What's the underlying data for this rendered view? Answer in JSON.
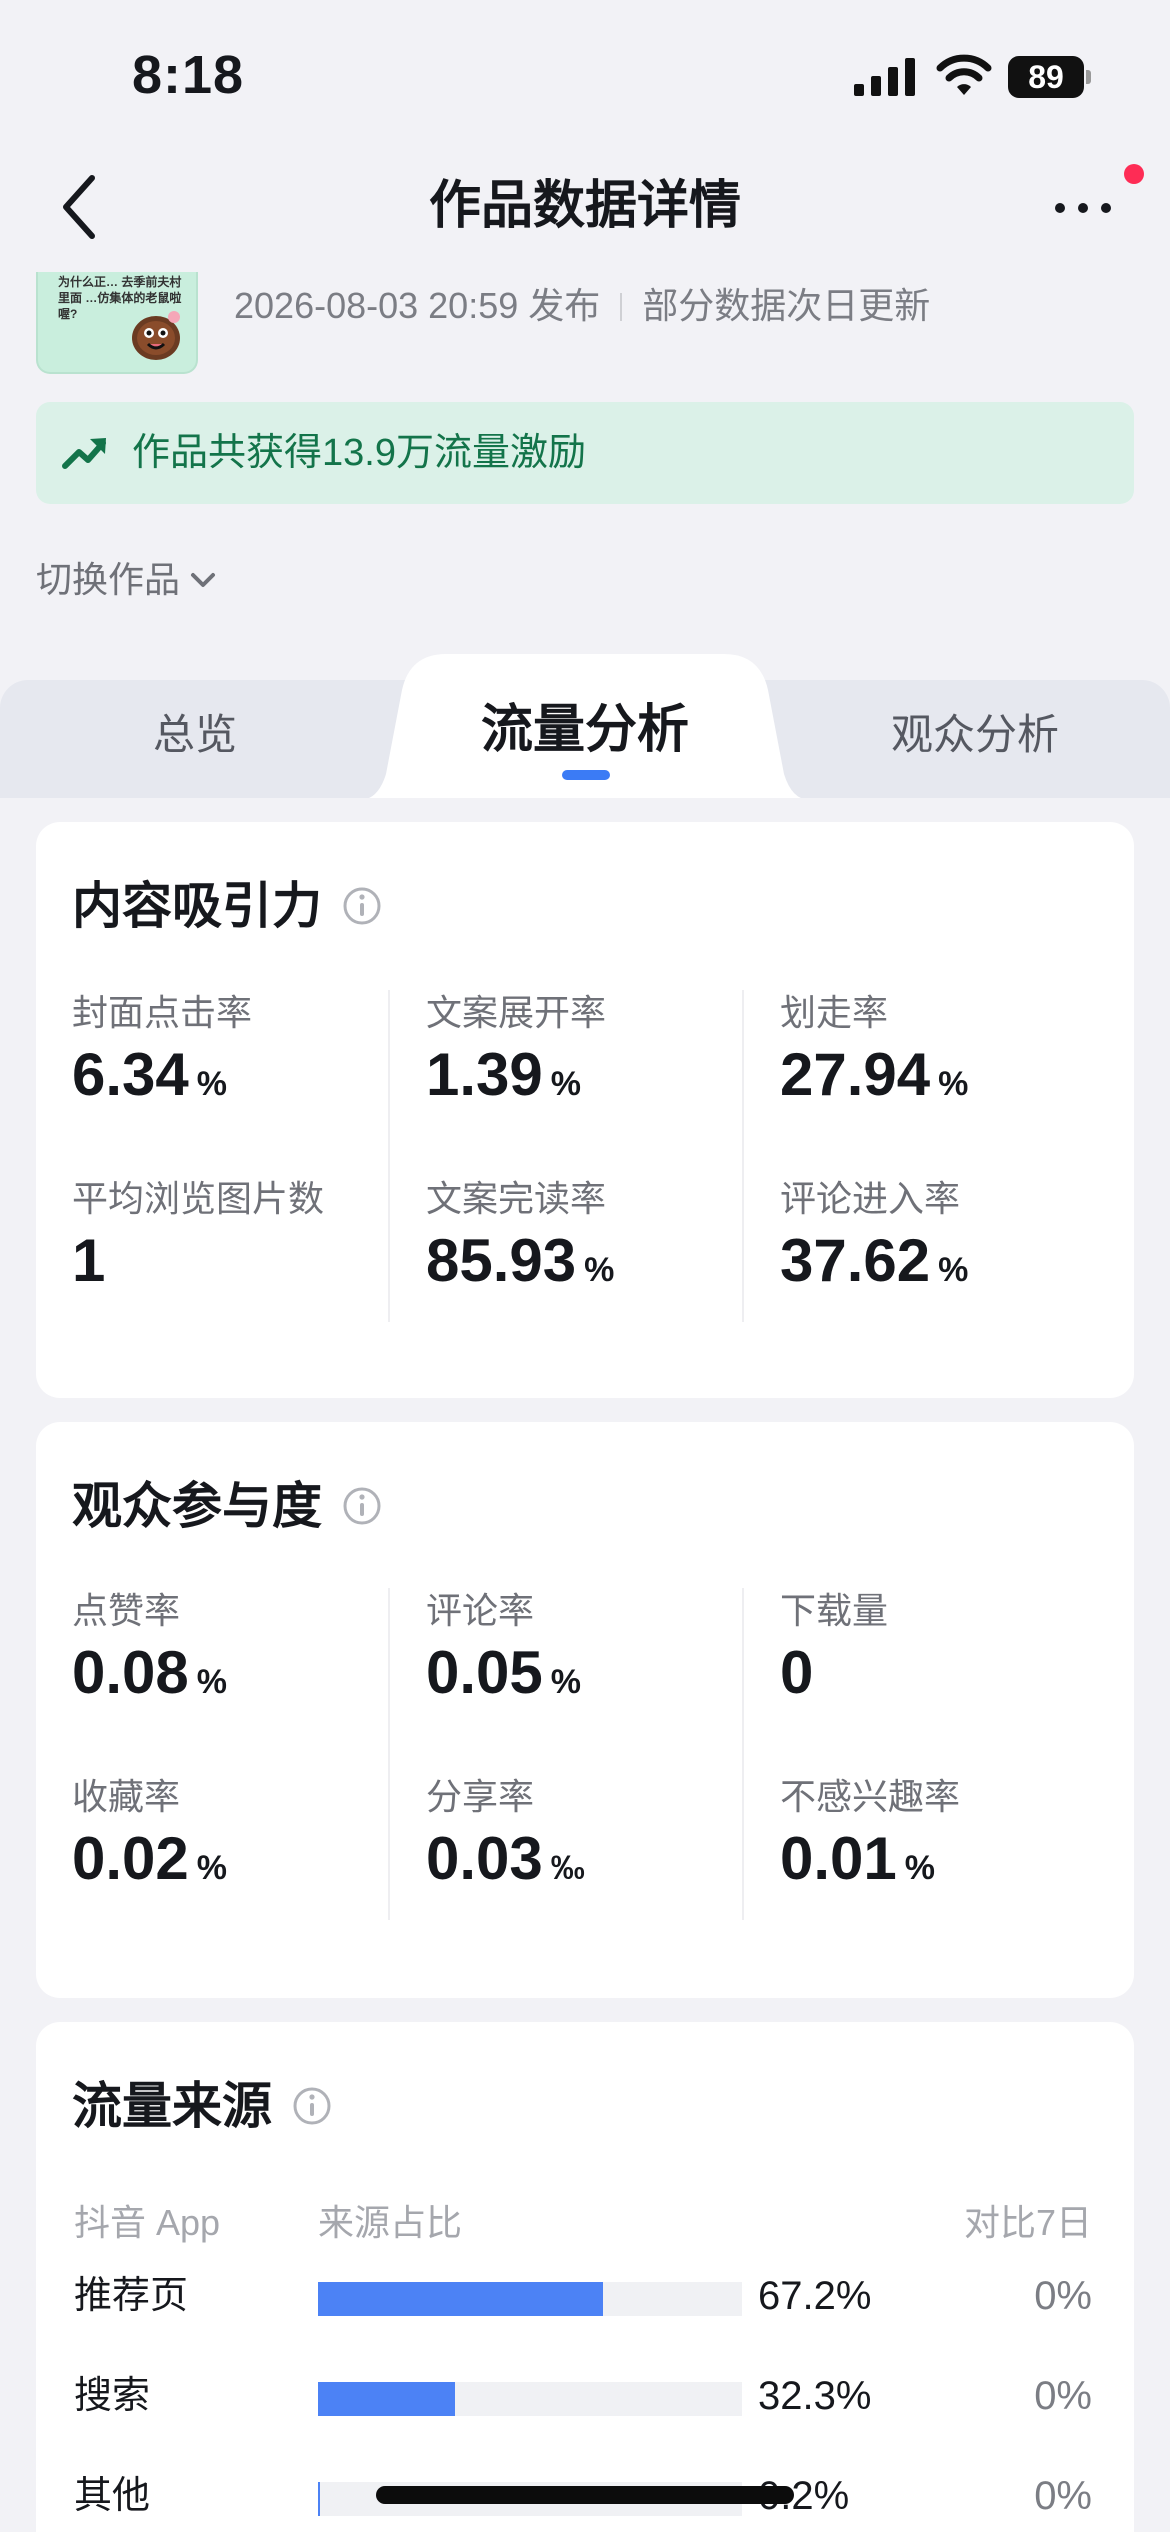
{
  "status_bar": {
    "time": "8:18",
    "battery": "89"
  },
  "nav": {
    "title": "作品数据详情"
  },
  "work": {
    "thumb_text": "为什么正… 去季前夫村里面 …仿集体的老鼠啦喔?",
    "publish_time": "2026-08-03 20:59 发布",
    "update_note": "部分数据次日更新"
  },
  "reward": {
    "text": "作品共获得13.9万流量激励"
  },
  "switch_work": {
    "label": "切换作品"
  },
  "tabs": [
    {
      "label": "总览"
    },
    {
      "label": "流量分析",
      "active": true
    },
    {
      "label": "观众分析"
    }
  ],
  "content_appeal": {
    "title": "内容吸引力",
    "metrics": [
      {
        "label": "封面点击率",
        "value": "6.34",
        "unit": "%"
      },
      {
        "label": "文案展开率",
        "value": "1.39",
        "unit": "%"
      },
      {
        "label": "划走率",
        "value": "27.94",
        "unit": "%"
      },
      {
        "label": "平均浏览图片数",
        "value": "1",
        "unit": ""
      },
      {
        "label": "文案完读率",
        "value": "85.93",
        "unit": "%"
      },
      {
        "label": "评论进入率",
        "value": "37.62",
        "unit": "%"
      }
    ]
  },
  "engagement": {
    "title": "观众参与度",
    "metrics": [
      {
        "label": "点赞率",
        "value": "0.08",
        "unit": "%"
      },
      {
        "label": "评论率",
        "value": "0.05",
        "unit": "%"
      },
      {
        "label": "下载量",
        "value": "0",
        "unit": ""
      },
      {
        "label": "收藏率",
        "value": "0.02",
        "unit": "%"
      },
      {
        "label": "分享率",
        "value": "0.03",
        "unit": "‰"
      },
      {
        "label": "不感兴趣率",
        "value": "0.01",
        "unit": "%"
      }
    ]
  },
  "traffic_source": {
    "title": "流量来源",
    "col_app": "抖音 App",
    "col_share": "来源占比",
    "col_compare": "对比7日",
    "rows": [
      {
        "name": "推荐页",
        "share": 67.2,
        "share_text": "67.2%",
        "compare": "0%"
      },
      {
        "name": "搜索",
        "share": 32.3,
        "share_text": "32.3%",
        "compare": "0%"
      },
      {
        "name": "其他",
        "share": 0.2,
        "share_text": "0.2%",
        "compare": "0%"
      }
    ]
  },
  "colors": {
    "accent_blue": "#3b7bf5",
    "bar_blue": "#4c82f5",
    "reward_green": "#13744a",
    "reward_bg": "#dbf1e8",
    "notify_red": "#fe2c55"
  },
  "icons": [
    "back-icon",
    "more-icon",
    "signal-icon",
    "wifi-icon",
    "trend-up-icon",
    "chevron-down-icon",
    "info-icon"
  ]
}
